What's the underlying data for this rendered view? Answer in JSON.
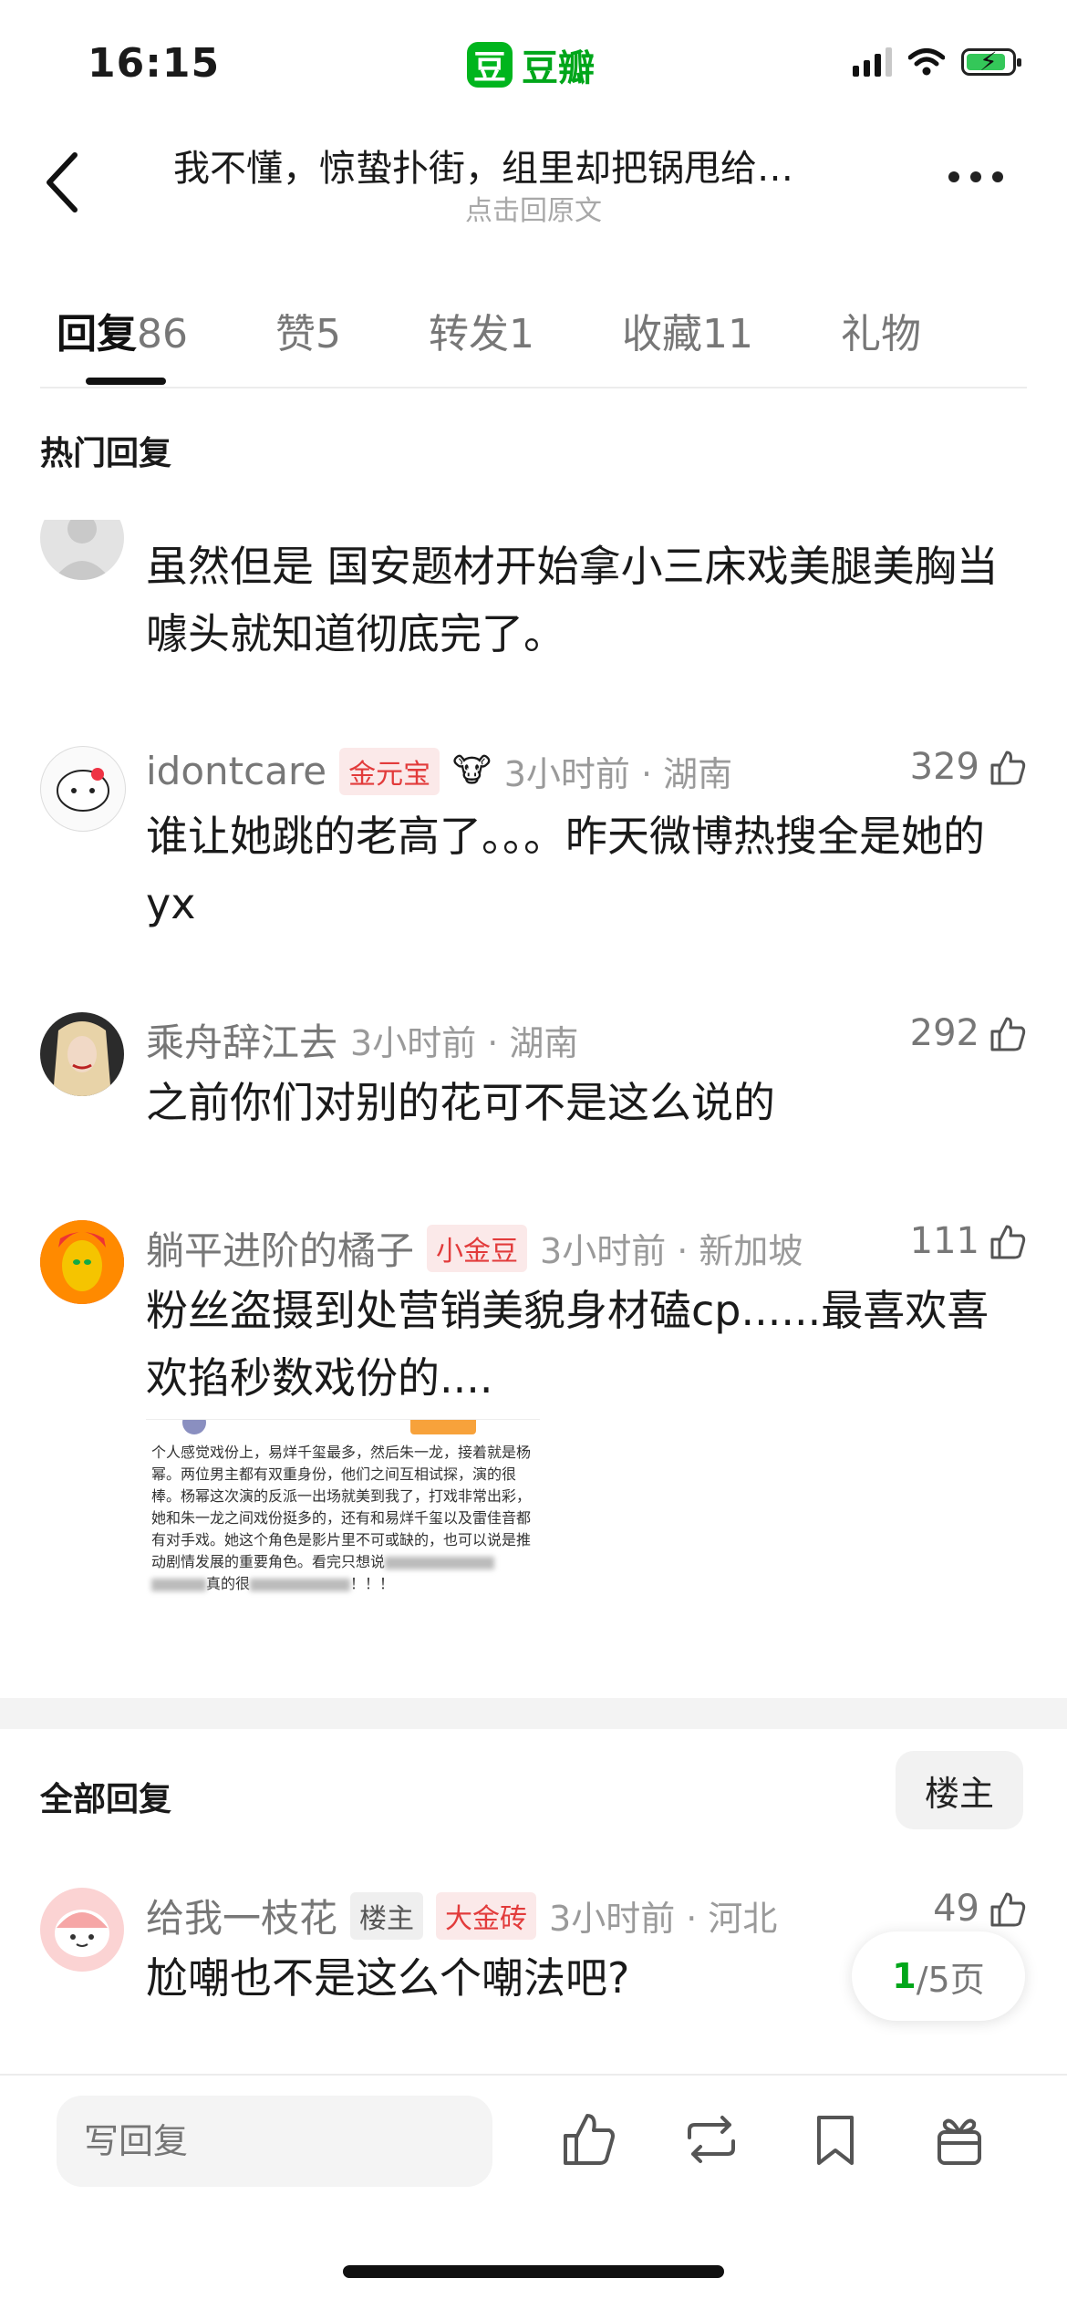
{
  "status_bar": {
    "time": "16:15",
    "app_logo": "豆",
    "app_name": "豆瓣"
  },
  "header": {
    "title": "我不懂，惊蛰扑街，组里却把锅甩给…",
    "subtitle": "点击回原文"
  },
  "tabs": [
    {
      "label": "回复",
      "count": "86",
      "active": true
    },
    {
      "label": "赞",
      "count": "5"
    },
    {
      "label": "转发",
      "count": "1"
    },
    {
      "label": "收藏",
      "count": "11"
    },
    {
      "label": "礼物",
      "count": ""
    }
  ],
  "hot_section_title": "热门回复",
  "hot_comments": [
    {
      "user": "",
      "text": "虽然但是  国安题材开始拿小三床戏美腿美胸当噱头就知道彻底完了。"
    },
    {
      "user": "idontcare",
      "badge": "金元宝",
      "meta": "3小时前 · 湖南",
      "likes": "329",
      "text": "谁让她跳的老高了。。。昨天微博热搜全是她的yx"
    },
    {
      "user": "乘舟辞江去",
      "meta": "3小时前 · 湖南",
      "likes": "292",
      "text": "之前你们对别的花可不是这么说的"
    },
    {
      "user": "躺平进阶的橘子",
      "badge": "小金豆",
      "meta": "3小时前 · 新加坡",
      "likes": "111",
      "text": "粉丝盗摄到处营销美貌身材磕cp......最喜欢喜欢掐秒数戏份的...."
    }
  ],
  "embedded_image": {
    "text": "个人感觉戏份上，易烊千玺最多，然后朱一龙，接着就是杨幂。两位男主都有双重身份，他们之间互相试探，演的很棒。杨幂这次演的反派一出场就美到我了，打戏非常出彩，她和朱一龙之间戏份挺多的，还有和易烊千玺以及雷佳音都有对手戏。她这个角色是影片里不可或缺的，也可以说是推动剧情发展的重要角色。看完只想说",
    "tail": "真的很",
    "end": "！！！"
  },
  "all_section_title": "全部回复",
  "owner_filter_label": "楼主",
  "all_comments": [
    {
      "user": "给我一枝花",
      "badge_owner": "楼主",
      "badge": "大金砖",
      "meta": "3小时前 · 河北",
      "likes": "49",
      "text": "尬嘲也不是这么个嘲法吧?"
    }
  ],
  "pager": {
    "current": "1",
    "total": "/5页"
  },
  "bottom_bar": {
    "reply_placeholder": "写回复"
  },
  "colors": {
    "brand": "#00b51d",
    "badge_red": "#e23b3b",
    "badge_bg": "#fbe9e9"
  }
}
